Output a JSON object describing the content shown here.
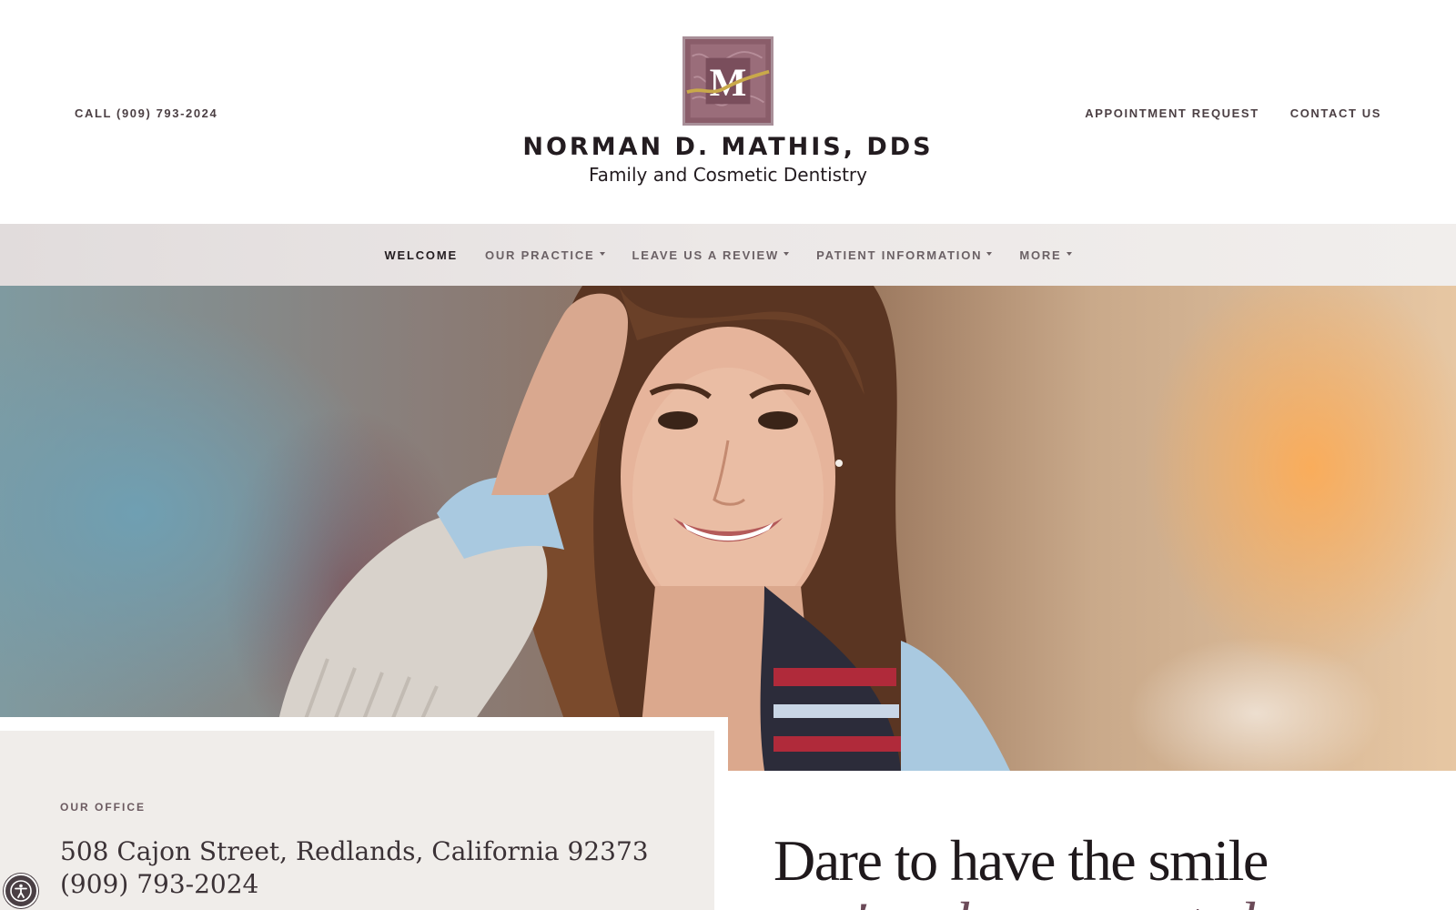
{
  "header": {
    "call_label": "CALL (909) 793-2024",
    "links": [
      {
        "label": "APPOINTMENT REQUEST"
      },
      {
        "label": "CONTACT US"
      }
    ],
    "logo_letter": "M",
    "practice_name": "NORMAN D. MATHIS, DDS",
    "practice_subtitle": "Family and Cosmetic Dentistry"
  },
  "nav": {
    "items": [
      {
        "label": "WELCOME",
        "active": true,
        "dropdown": false
      },
      {
        "label": "OUR PRACTICE",
        "active": false,
        "dropdown": true
      },
      {
        "label": "LEAVE US A REVIEW",
        "active": false,
        "dropdown": true
      },
      {
        "label": "PATIENT INFORMATION",
        "active": false,
        "dropdown": true
      },
      {
        "label": "MORE",
        "active": false,
        "dropdown": true
      }
    ]
  },
  "hero": {
    "image_icon": "smiling-woman-photo"
  },
  "office": {
    "label": "OUR OFFICE",
    "address": "508 Cajon Street, Redlands, California 92373",
    "phone": "(909) 793-2024"
  },
  "headline": {
    "line1": "Dare to have the smile",
    "line2": "you've always wanted"
  },
  "accessibility": {
    "icon": "accessibility-icon"
  },
  "colors": {
    "brand_plum": "#8a5d6a",
    "accent_gold": "#c9a94a",
    "text_dark": "#231c20",
    "office_bg": "#f0edea"
  }
}
